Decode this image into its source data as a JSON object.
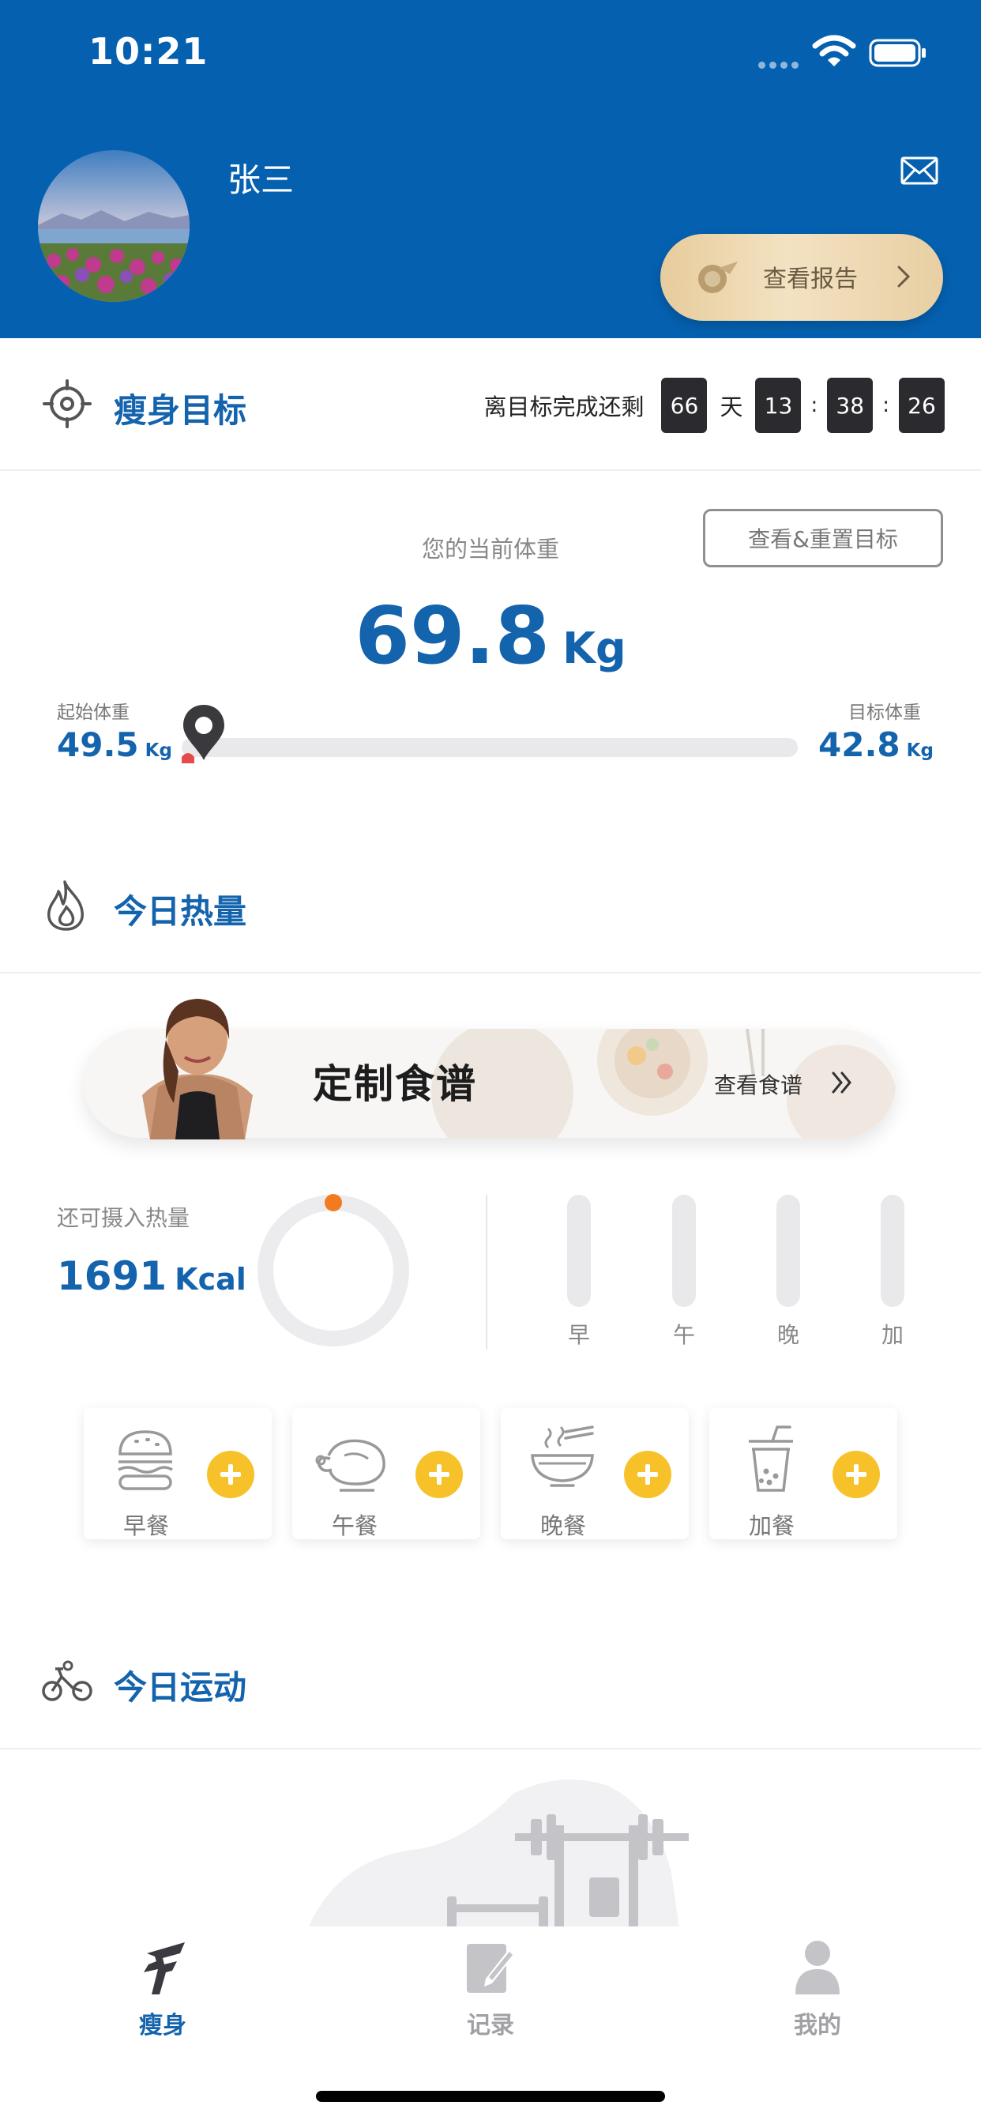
{
  "status_bar": {
    "time": "10:21"
  },
  "profile": {
    "name": "张三",
    "report_button": "查看报告"
  },
  "slim_goal": {
    "title": "瘦身目标",
    "countdown_label": "离目标完成还剩",
    "days": "66",
    "day_unit": "天",
    "hours": "13",
    "minutes": "38",
    "seconds": "26",
    "separator": ":",
    "reset_button": "查看&重置目标",
    "current_label": "您的当前体重",
    "current_value": "69.8",
    "unit": "Kg",
    "start_label": "起始体重",
    "start_value": "49.5",
    "target_label": "目标体重",
    "target_value": "42.8",
    "small_unit": "Kg",
    "progress_fraction": 0.0
  },
  "calories": {
    "title": "今日热量",
    "banner_title": "定制食谱",
    "banner_link": "查看食谱",
    "remaining_label": "还可摄入热量",
    "remaining_value": "1691",
    "remaining_unit": "Kcal",
    "meal_bars": [
      "早",
      "午",
      "晚",
      "加"
    ],
    "meals": [
      {
        "name": "早餐",
        "icon": "burger-icon"
      },
      {
        "name": "午餐",
        "icon": "roast-chicken-icon"
      },
      {
        "name": "晚餐",
        "icon": "noodle-bowl-icon"
      },
      {
        "name": "加餐",
        "icon": "bubble-tea-icon"
      }
    ]
  },
  "exercise": {
    "title": "今日运动"
  },
  "tabs": [
    {
      "label": "瘦身",
      "icon": "slim-icon",
      "active": true
    },
    {
      "label": "记录",
      "icon": "record-icon",
      "active": false
    },
    {
      "label": "我的",
      "icon": "profile-icon",
      "active": false
    }
  ],
  "colors": {
    "brand_blue": "#0561b0",
    "accent_text": "#1463ad",
    "add_yellow": "#f7c229",
    "ring_dot": "#f47a20"
  }
}
